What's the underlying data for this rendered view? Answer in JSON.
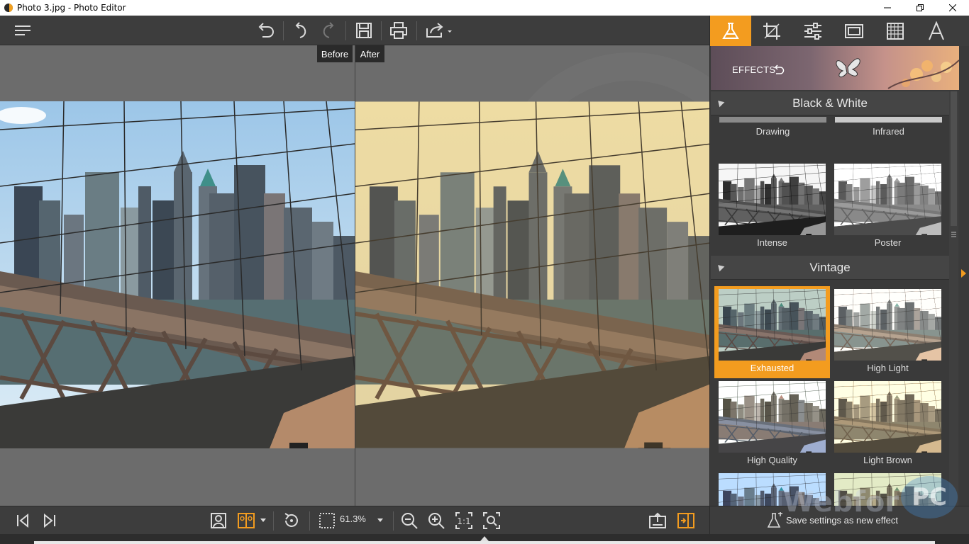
{
  "window": {
    "title": "Photo 3.jpg - Photo Editor",
    "controls": [
      "minimize",
      "maximize",
      "close"
    ]
  },
  "toolbar": {
    "icons": [
      "menu-icon",
      "undo-all-icon",
      "undo-icon",
      "redo-icon",
      "save-icon",
      "print-icon",
      "share-icon"
    ]
  },
  "compare": {
    "before_label": "Before",
    "after_label": "After"
  },
  "bottombar": {
    "zoom_value": "61.3%",
    "icons": [
      "first-image-icon",
      "last-image-icon",
      "single-view-icon",
      "compare-view-icon",
      "rotate-icon",
      "fit-icon",
      "zoom-out-icon",
      "zoom-in-icon",
      "actual-size-icon",
      "zoom-fit-icon",
      "export-icon",
      "panel-toggle-icon"
    ]
  },
  "panel": {
    "tabs": [
      "effects-tab",
      "crop-tab",
      "adjust-tab",
      "frame-tab",
      "texture-tab",
      "text-tab"
    ],
    "active_tab": "effects-tab",
    "banner_label": "EFFECTS",
    "sections": [
      {
        "title": "Black & White",
        "partial_items": [
          "Drawing",
          "Infrared"
        ],
        "items": [
          "Intense",
          "Poster"
        ]
      },
      {
        "title": "Vintage",
        "items": [
          "Exhausted",
          "High Light",
          "High Quality",
          "Light Brown"
        ],
        "selected": "Exhausted"
      }
    ],
    "footer_label": "Save settings as new effect"
  },
  "watermark": {
    "text": "Webfor",
    "badge": "PC"
  },
  "colors": {
    "accent": "#f39c1f",
    "toolbar_bg": "#3d3d3d",
    "canvas_bg": "#6c6c6c"
  }
}
